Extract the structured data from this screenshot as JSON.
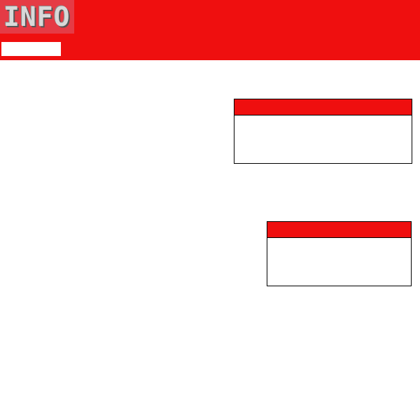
{
  "colors": {
    "brand_red": "#ef0f0f",
    "logo_tile": "#e53b45",
    "panel_border": "#000000",
    "background": "#ffffff"
  },
  "header": {
    "logo_text": "INFO",
    "search_value": ""
  },
  "panels": [
    {
      "title": "",
      "body": ""
    },
    {
      "title": "",
      "body": ""
    }
  ]
}
